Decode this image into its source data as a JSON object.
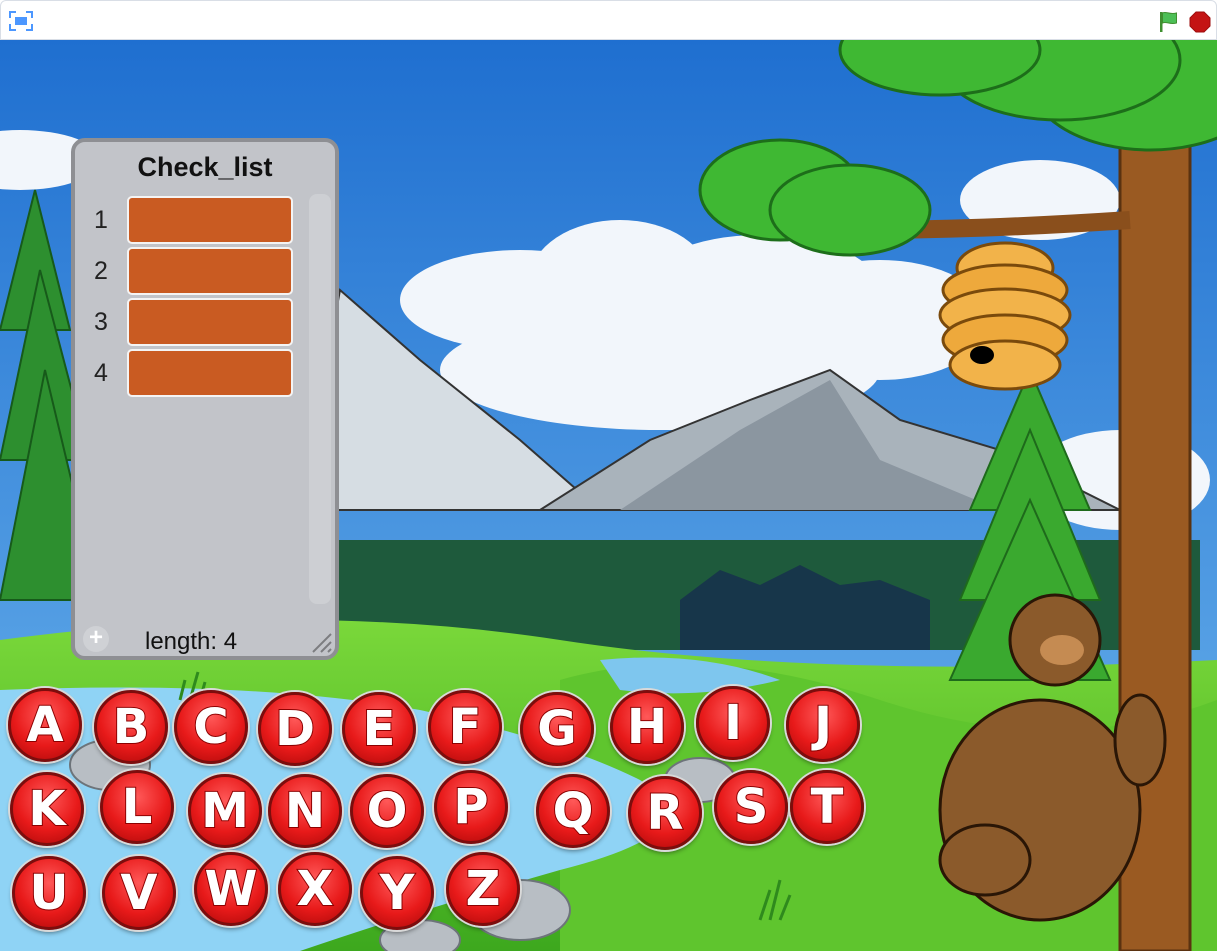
{
  "toolbar": {
    "fullscreen_icon": "fullscreen-icon",
    "green_flag_icon": "green-flag-icon",
    "stop_icon": "stop-sign-icon",
    "flag_color": "#4cbf56",
    "stop_color": "#c41414"
  },
  "list_monitor": {
    "title": "Check_list",
    "items": [
      {
        "index": "1",
        "value": ""
      },
      {
        "index": "2",
        "value": ""
      },
      {
        "index": "3",
        "value": ""
      },
      {
        "index": "4",
        "value": ""
      }
    ],
    "add_symbol": "+",
    "length_label": "length: 4",
    "cell_color": "#c95b22"
  },
  "letters": [
    "A",
    "B",
    "C",
    "D",
    "E",
    "F",
    "G",
    "H",
    "I",
    "J",
    "K",
    "L",
    "M",
    "N",
    "O",
    "P",
    "Q",
    "R",
    "S",
    "T",
    "U",
    "V",
    "W",
    "X",
    "Y",
    "Z"
  ],
  "colors": {
    "sky": "#2e7fd6",
    "grass": "#4fc62a",
    "water": "#8fd3f5",
    "button_red": "#e81a1a"
  }
}
